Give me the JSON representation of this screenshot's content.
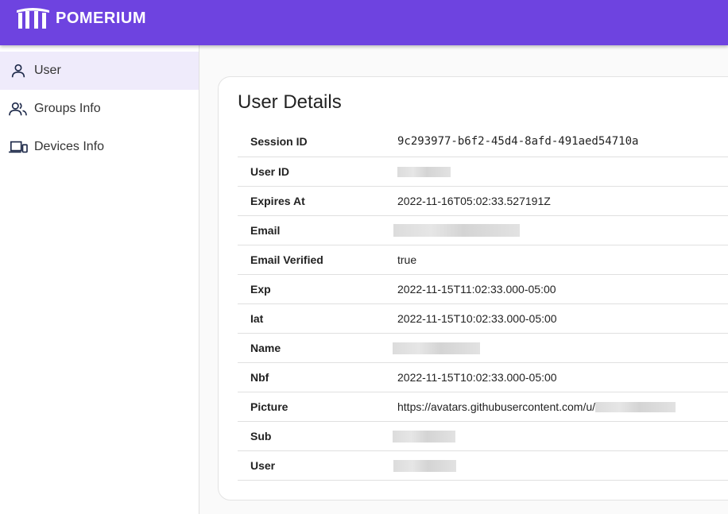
{
  "header": {
    "brand": "POMERIUM",
    "logo_icon": "pomerium-logo-icon",
    "background": "#6e43e0"
  },
  "sidebar": {
    "items": [
      {
        "label": "User",
        "icon": "person-icon",
        "active": true
      },
      {
        "label": "Groups Info",
        "icon": "people-icon",
        "active": false
      },
      {
        "label": "Devices Info",
        "icon": "devices-icon",
        "active": false
      }
    ]
  },
  "main": {
    "title": "User Details",
    "rows": [
      {
        "key": "Session ID",
        "value": "9c293977-b6f2-45d4-8afd-491aed54710a"
      },
      {
        "key": "User ID",
        "value": ""
      },
      {
        "key": "Expires At",
        "value": "2022-11-16T05:02:33.527191Z"
      },
      {
        "key": "Email",
        "value": ""
      },
      {
        "key": "Email Verified",
        "value": "true"
      },
      {
        "key": "Exp",
        "value": "2022-11-15T11:02:33.000-05:00"
      },
      {
        "key": "Iat",
        "value": "2022-11-15T10:02:33.000-05:00"
      },
      {
        "key": "Name",
        "value": ""
      },
      {
        "key": "Nbf",
        "value": "2022-11-15T10:02:33.000-05:00"
      },
      {
        "key": "Picture",
        "value": "https://avatars.githubusercontent.com/u/"
      },
      {
        "key": "Sub",
        "value": ""
      },
      {
        "key": "User",
        "value": ""
      }
    ]
  }
}
